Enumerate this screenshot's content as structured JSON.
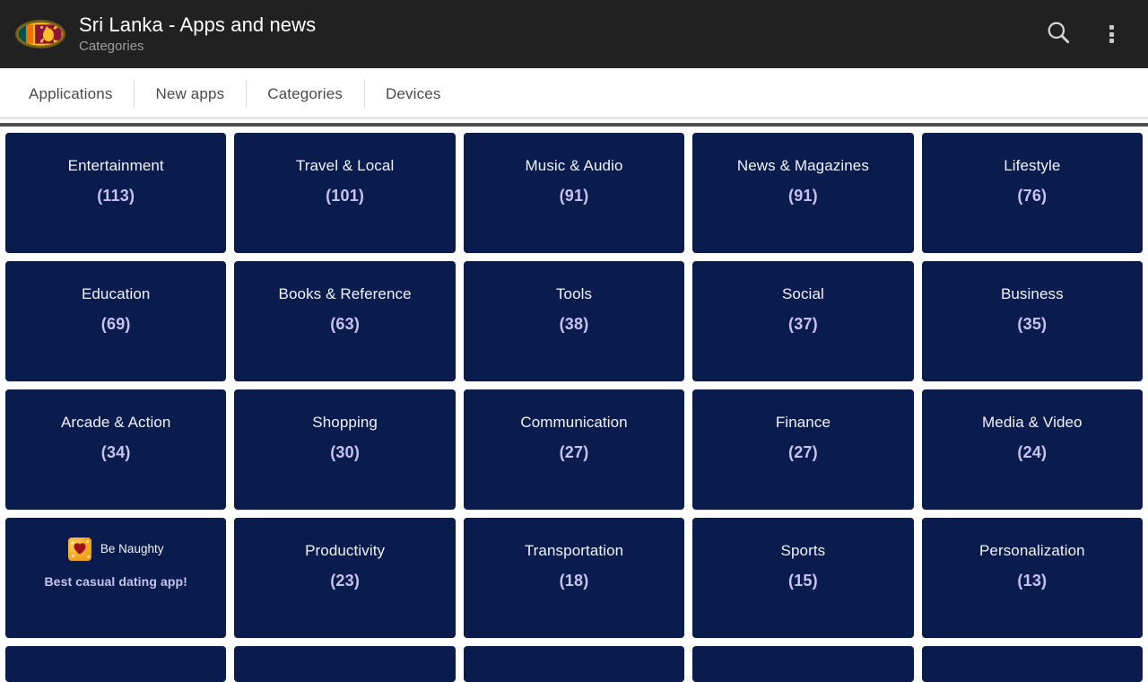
{
  "appbar": {
    "icon_name": "sri-lanka-flag-icon",
    "title": "Sri Lanka - Apps and news",
    "subtitle": "Categories",
    "search_icon": "search-icon",
    "overflow_icon": "overflow-menu-icon",
    "background": "#212121",
    "title_color": "#ffffff",
    "subtitle_color": "#9e9e9e"
  },
  "tabs": {
    "items": [
      {
        "label": "Applications"
      },
      {
        "label": "New apps"
      },
      {
        "label": "Categories"
      },
      {
        "label": "Devices"
      }
    ],
    "selected": "Categories",
    "text_color": "#4a4a4a"
  },
  "grid": {
    "tile_color": "#0a1b4d",
    "label_color": "#f2f3f8",
    "count_color": "#c7c3ef",
    "rows": [
      [
        {
          "type": "category",
          "label": "Entertainment",
          "count": "(113)"
        },
        {
          "type": "category",
          "label": "Travel & Local",
          "count": "(101)"
        },
        {
          "type": "category",
          "label": "Music & Audio",
          "count": "(91)"
        },
        {
          "type": "category",
          "label": "News & Magazines",
          "count": "(91)"
        },
        {
          "type": "category",
          "label": "Lifestyle",
          "count": "(76)"
        }
      ],
      [
        {
          "type": "category",
          "label": "Education",
          "count": "(69)"
        },
        {
          "type": "category",
          "label": "Books & Reference",
          "count": "(63)"
        },
        {
          "type": "category",
          "label": "Tools",
          "count": "(38)"
        },
        {
          "type": "category",
          "label": "Social",
          "count": "(37)"
        },
        {
          "type": "category",
          "label": "Business",
          "count": "(35)"
        }
      ],
      [
        {
          "type": "category",
          "label": "Arcade & Action",
          "count": "(34)"
        },
        {
          "type": "category",
          "label": "Shopping",
          "count": "(30)"
        },
        {
          "type": "category",
          "label": "Communication",
          "count": "(27)"
        },
        {
          "type": "category",
          "label": "Finance",
          "count": "(27)"
        },
        {
          "type": "category",
          "label": "Media & Video",
          "count": "(24)"
        }
      ],
      [
        {
          "type": "ad",
          "ad_name": "Be Naughty",
          "ad_tagline": "Best casual dating app!",
          "ad_icon": "heart-app-icon"
        },
        {
          "type": "category",
          "label": "Productivity",
          "count": "(23)"
        },
        {
          "type": "category",
          "label": "Transportation",
          "count": "(18)"
        },
        {
          "type": "category",
          "label": "Sports",
          "count": "(15)"
        },
        {
          "type": "category",
          "label": "Personalization",
          "count": "(13)"
        }
      ]
    ],
    "partial_row_tiles": 5
  }
}
